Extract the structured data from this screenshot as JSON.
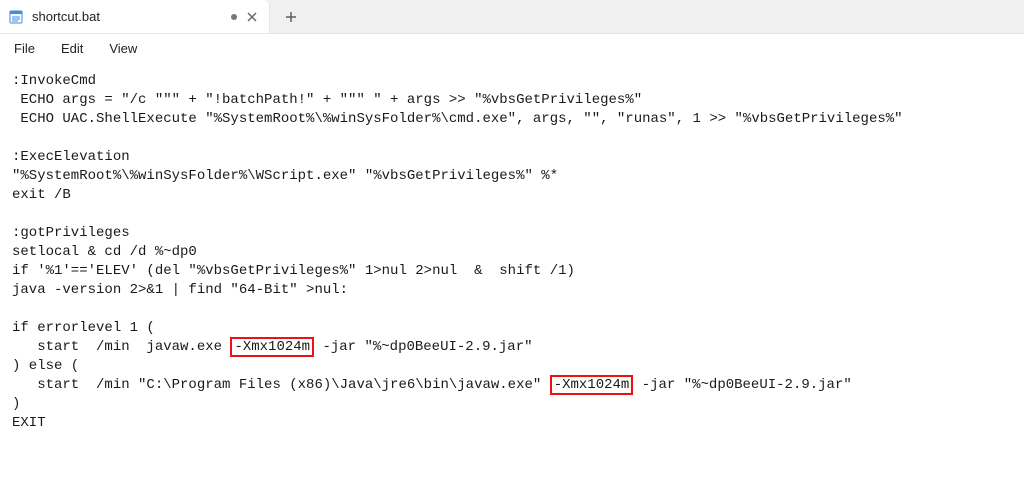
{
  "tab": {
    "title": "shortcut.bat",
    "dirty": true
  },
  "menubar": {
    "file": "File",
    "edit": "Edit",
    "view": "View"
  },
  "editor": {
    "line1": ":InvokeCmd",
    "line2": " ECHO args = \"/c \"\"\" + \"!batchPath!\" + \"\"\" \" + args >> \"%vbsGetPrivileges%\"",
    "line3": " ECHO UAC.ShellExecute \"%SystemRoot%\\%winSysFolder%\\cmd.exe\", args, \"\", \"runas\", 1 >> \"%vbsGetPrivileges%\"",
    "line5": ":ExecElevation",
    "line6": "\"%SystemRoot%\\%winSysFolder%\\WScript.exe\" \"%vbsGetPrivileges%\" %*",
    "line7": "exit /B",
    "line9": ":gotPrivileges",
    "line10": "setlocal & cd /d %~dp0",
    "line11": "if '%1'=='ELEV' (del \"%vbsGetPrivileges%\" 1>nul 2>nul  &  shift /1)",
    "line12": "java -version 2>&1 | find \"64-Bit\" >nul:",
    "line14": "if errorlevel 1 (",
    "line15a": "   start  /min  javaw.exe ",
    "hl1": "-Xmx1024m",
    "line15b": " -jar \"%~dp0BeeUI-2.9.jar\"",
    "line16": ") else (",
    "line17a": "   start  /min \"C:\\Program Files (x86)\\Java\\jre6\\bin\\javaw.exe\" ",
    "hl2": "-Xmx1024m",
    "line17b": " -jar \"%~dp0BeeUI-2.9.jar\"",
    "line18": ")",
    "line19": "EXIT"
  }
}
